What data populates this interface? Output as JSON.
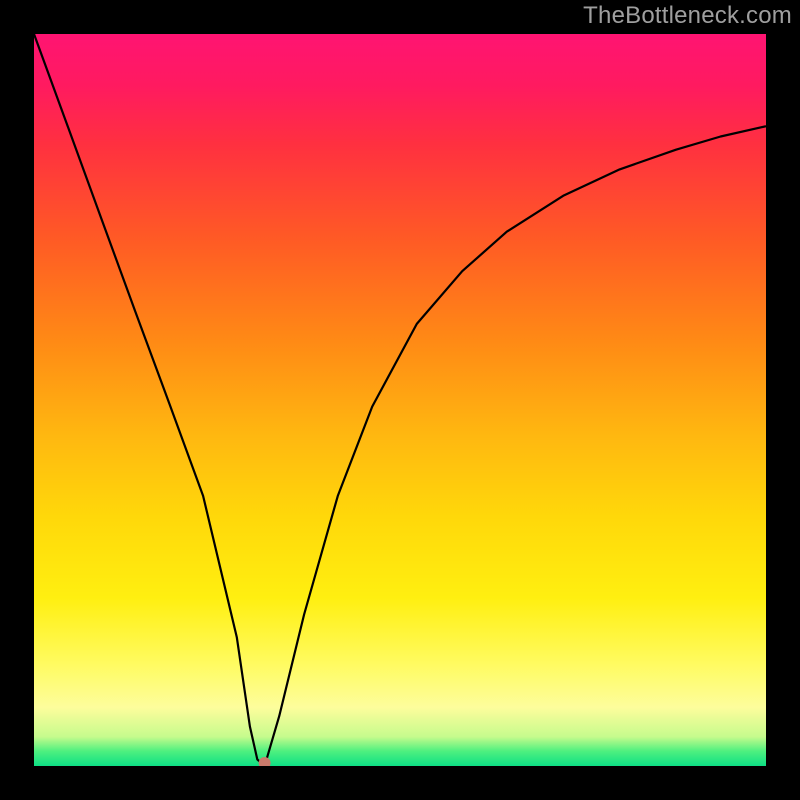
{
  "attribution": "TheBottleneck.com",
  "chart_data": {
    "type": "line",
    "title": "",
    "xlabel": "",
    "ylabel": "",
    "xrange": [
      0,
      100
    ],
    "yrange": [
      0,
      100
    ],
    "series": [
      {
        "name": "bottleneck-curve",
        "x": [
          0.0,
          4.6,
          9.2,
          13.8,
          18.5,
          23.1,
          27.7,
          29.5,
          30.5,
          31.5,
          33.5,
          36.9,
          41.5,
          46.2,
          52.3,
          58.5,
          64.6,
          72.3,
          80.0,
          87.7,
          93.8,
          100.0
        ],
        "y": [
          100.0,
          87.4,
          74.8,
          62.2,
          49.5,
          36.9,
          17.6,
          5.4,
          0.9,
          0.0,
          6.8,
          20.7,
          36.9,
          49.1,
          60.4,
          67.6,
          73.0,
          77.9,
          81.5,
          84.2,
          86.0,
          87.4
        ]
      }
    ],
    "minimum_point": {
      "x": 31.5,
      "y": 0.0
    },
    "gradient_stops": [
      {
        "pos": 0,
        "color": "#ff1472"
      },
      {
        "pos": 50,
        "color": "#ffbb10"
      },
      {
        "pos": 85,
        "color": "#fffb60"
      },
      {
        "pos": 100,
        "color": "#0ee085"
      }
    ]
  }
}
